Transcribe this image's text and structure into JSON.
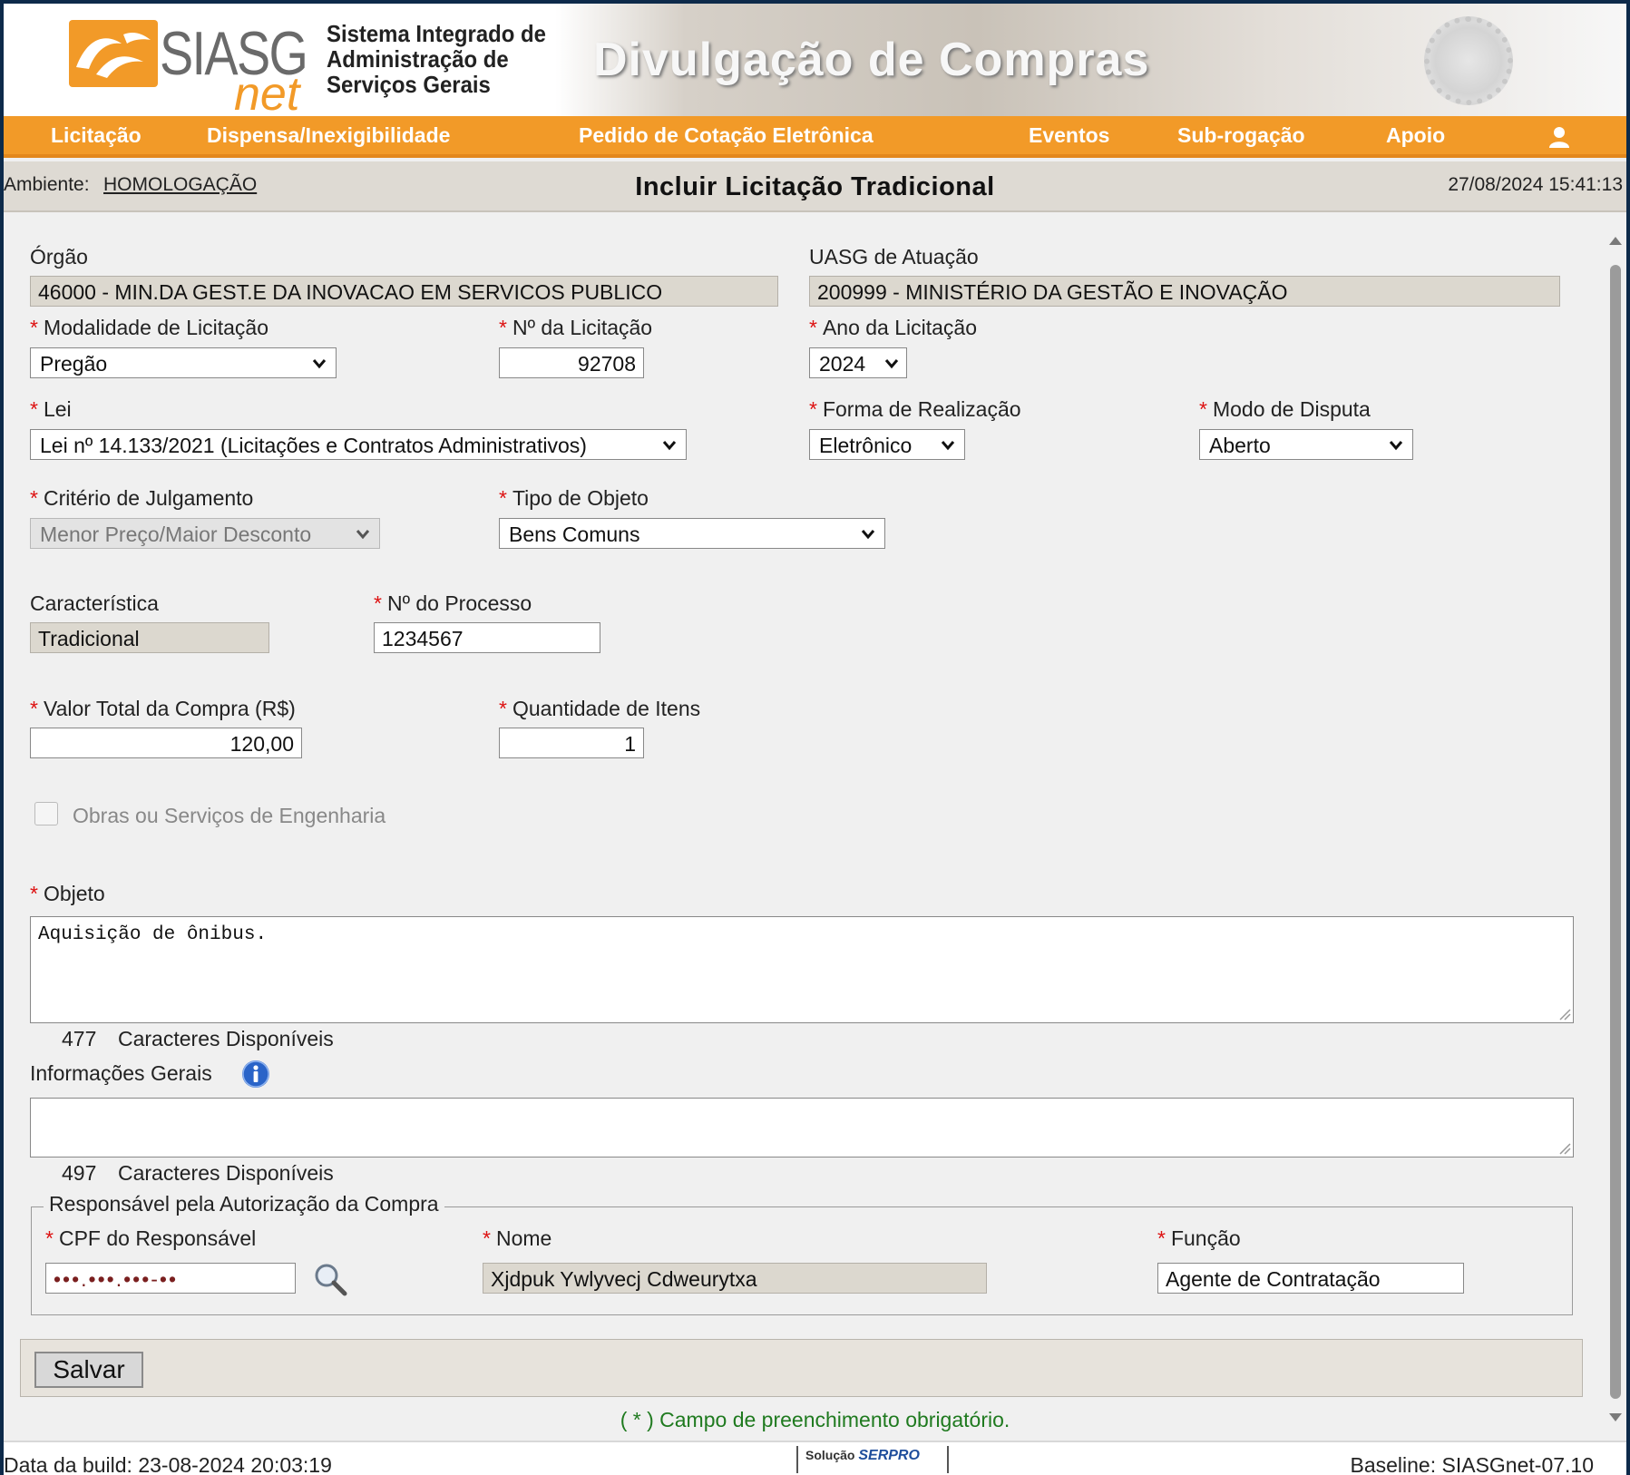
{
  "header": {
    "logo_text": "SIASG",
    "logo_net": "net",
    "system_name_lines": [
      "Sistema Integrado de",
      "Administração de",
      "Serviços Gerais"
    ],
    "banner_title": "Divulgação de Compras"
  },
  "nav": {
    "items": [
      "Licitação",
      "Dispensa/Inexigibilidade",
      "Pedido de Cotação Eletrônica",
      "Eventos",
      "Sub-rogação",
      "Apoio"
    ],
    "user_icon": "user-icon"
  },
  "titlebar": {
    "ambiente_label": "Ambiente:",
    "ambiente_value": "HOMOLOGAÇÃO",
    "page_title": "Incluir Licitação Tradicional",
    "datetime": "27/08/2024 15:41:13"
  },
  "form": {
    "required_mark": "*",
    "orgao": {
      "label": "Órgão",
      "value": "46000 - MIN.DA GEST.E DA INOVACAO EM SERVICOS PUBLICO"
    },
    "uasg": {
      "label": "UASG de Atuação",
      "value": "200999 - MINISTÉRIO DA GESTÃO E INOVAÇÃO"
    },
    "modalidade": {
      "label": "Modalidade de Licitação",
      "value": "Pregão"
    },
    "numero": {
      "label": "Nº da Licitação",
      "value": "92708"
    },
    "ano": {
      "label": "Ano da Licitação",
      "value": "2024"
    },
    "lei": {
      "label": "Lei",
      "value": "Lei nº 14.133/2021 (Licitações e Contratos Administrativos)"
    },
    "forma": {
      "label": "Forma de Realização",
      "value": "Eletrônico"
    },
    "modo": {
      "label": "Modo de Disputa",
      "value": "Aberto"
    },
    "criterio": {
      "label": "Critério de Julgamento",
      "value": "Menor Preço/Maior Desconto"
    },
    "tipo_objeto": {
      "label": "Tipo de Objeto",
      "value": "Bens Comuns"
    },
    "caracteristica": {
      "label": "Característica",
      "value": "Tradicional"
    },
    "processo": {
      "label": "Nº do Processo",
      "value": "1234567"
    },
    "valor_total": {
      "label": "Valor Total da Compra (R$)",
      "value": "120,00"
    },
    "quantidade": {
      "label": "Quantidade de Itens",
      "value": "1"
    },
    "obras": {
      "label": "Obras ou Serviços de Engenharia",
      "checked": false
    },
    "objeto": {
      "label": "Objeto",
      "value": "Aquisição de ônibus.",
      "count": "477",
      "count_label": "Caracteres Disponíveis"
    },
    "info_gerais": {
      "label": "Informações Gerais",
      "value": "",
      "count": "497",
      "count_label": "Caracteres Disponíveis",
      "icon": "info-icon"
    },
    "responsavel": {
      "legend": "Responsável pela Autorização da Compra",
      "cpf": {
        "label": "CPF do Responsável",
        "value": "•••.•••.•••-••"
      },
      "nome": {
        "label": "Nome",
        "value": "Xjdpuk Ywlyvecj Cdweurytxa"
      },
      "funcao": {
        "label": "Função",
        "value": "Agente de Contratação"
      }
    },
    "save_label": "Salvar",
    "required_note": "( * ) Campo de preenchimento obrigatório."
  },
  "footer": {
    "build": "Data da build: 23-08-2024 20:03:19",
    "solucao": "Solução",
    "brand": "SERPRO",
    "baseline": "Baseline: SIASGnet-07.10"
  },
  "colors": {
    "accent": "#f29a28",
    "required": "#dd1111",
    "note": "#1f7a1f"
  }
}
